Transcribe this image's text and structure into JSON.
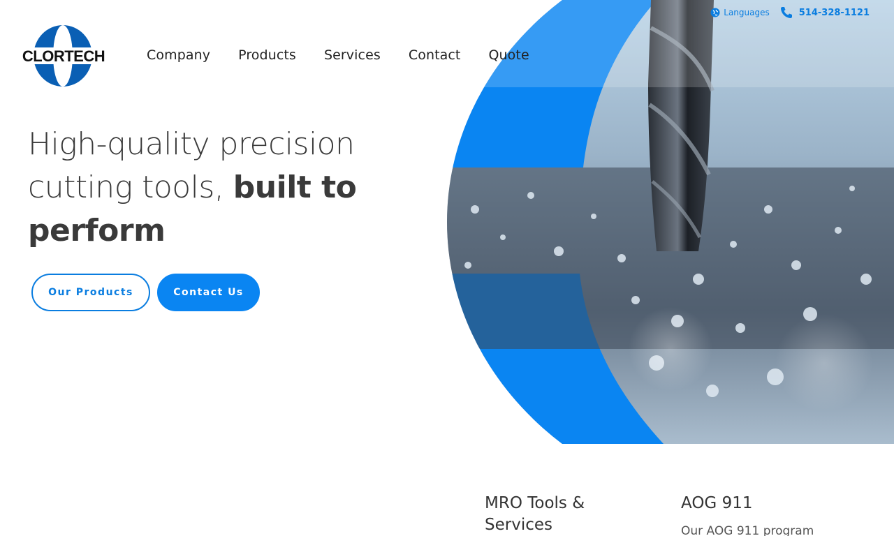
{
  "topbar": {
    "languages_label": "Languages",
    "phone": "514-328-1121"
  },
  "logo": {
    "text": "CLORTECH"
  },
  "nav": {
    "items": [
      {
        "label": "Company"
      },
      {
        "label": "Products"
      },
      {
        "label": "Services"
      },
      {
        "label": "Contact"
      },
      {
        "label": "Quote"
      }
    ]
  },
  "hero": {
    "headline_light": "High-quality precision cutting tools, ",
    "headline_bold": "built to perform",
    "buttons": {
      "products_label": "Our Products",
      "contact_label": "Contact Us"
    }
  },
  "cards": [
    {
      "title": "MRO Tools & Services",
      "text": ""
    },
    {
      "title": "AOG 911",
      "text": "Our AOG 911 program"
    }
  ],
  "colors": {
    "accent": "#0a85f2",
    "brand_blue": "#0a5fb4",
    "text_dark": "#333333"
  }
}
